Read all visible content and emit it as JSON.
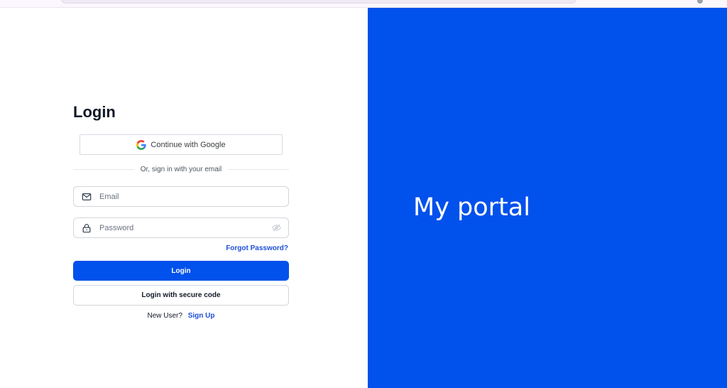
{
  "browser": {
    "icons": [
      "address-bar",
      "profile-dot"
    ]
  },
  "login": {
    "title": "Login",
    "google_label": "Continue with Google",
    "divider_text": "Or, sign in with your email",
    "email_placeholder": "Email",
    "password_placeholder": "Password",
    "forgot_label": "Forgot Password?",
    "login_label": "Login",
    "secure_label": "Login with secure code",
    "new_user_text": "New User?",
    "signup_label": "Sign Up"
  },
  "brand": {
    "name": "My portal",
    "background": "#0151ec"
  },
  "icons": {
    "google": "google-g-icon",
    "email": "mail-icon",
    "password": "lock-icon",
    "visibility": "eye-icon"
  },
  "colors": {
    "primary": "#0151ec",
    "link": "#1d4fd8"
  }
}
